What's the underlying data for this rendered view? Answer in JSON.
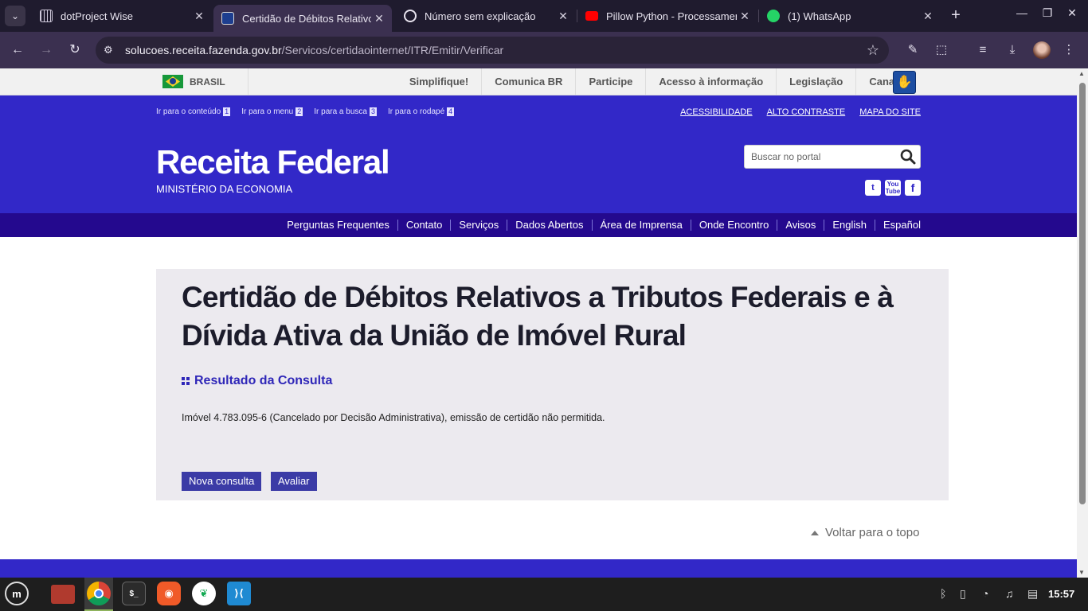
{
  "browser": {
    "tabs": [
      {
        "title": "dotProject Wise",
        "icon": "grid-favicon",
        "active": false
      },
      {
        "title": "Certidão de Débitos Relativos",
        "icon": "receita-favicon",
        "active": true
      },
      {
        "title": "Número sem explicação",
        "icon": "chatgpt-favicon",
        "active": false
      },
      {
        "title": "Pillow Python - Processamento",
        "icon": "youtube-favicon",
        "active": false
      },
      {
        "title": "(1) WhatsApp",
        "icon": "whatsapp-favicon",
        "active": false
      }
    ],
    "url_host": "solucoes.receita.fazenda.gov.br",
    "url_path": "/Servicos/certidaointernet/ITR/Emitir/Verificar",
    "close_glyph": "✕",
    "new_tab_glyph": "+"
  },
  "govbar": {
    "country": "BRASIL",
    "links": [
      "Simplifique!",
      "Comunica BR",
      "Participe",
      "Acesso à informação",
      "Legislação",
      "Canais"
    ]
  },
  "header": {
    "skip_links": [
      {
        "label": "Ir para o conteúdo",
        "key": "1"
      },
      {
        "label": "Ir para o menu",
        "key": "2"
      },
      {
        "label": "Ir para a busca",
        "key": "3"
      },
      {
        "label": "Ir para o rodapé",
        "key": "4"
      }
    ],
    "top_links": [
      "ACESSIBILIDADE",
      "ALTO CONTRASTE",
      "MAPA DO SITE"
    ],
    "brand": "Receita Federal",
    "subbrand": "MINISTÉRIO DA ECONOMIA",
    "search_placeholder": "Buscar no portal",
    "menu": [
      "Perguntas Frequentes",
      "Contato",
      "Serviços",
      "Dados Abertos",
      "Área de Imprensa",
      "Onde Encontro",
      "Avisos",
      "English",
      "Español"
    ]
  },
  "content": {
    "title": "Certidão de Débitos Relativos a Tributos Federais e à Dívida Ativa da União de Imóvel Rural",
    "result_heading": "Resultado da Consulta",
    "message": "Imóvel 4.783.095-6 (Cancelado por Decisão Administrativa), emissão de certidão não permitida.",
    "buttons": {
      "new_query": "Nova consulta",
      "evaluate": "Avaliar"
    },
    "back_to_top": "Voltar para o topo"
  },
  "taskbar": {
    "clock": "15:57"
  },
  "colors": {
    "header_blue": "#3228c8",
    "menu_blue": "#24098e",
    "button_blue": "#3b3ba6",
    "browser_dark": "#1f1b2e"
  }
}
